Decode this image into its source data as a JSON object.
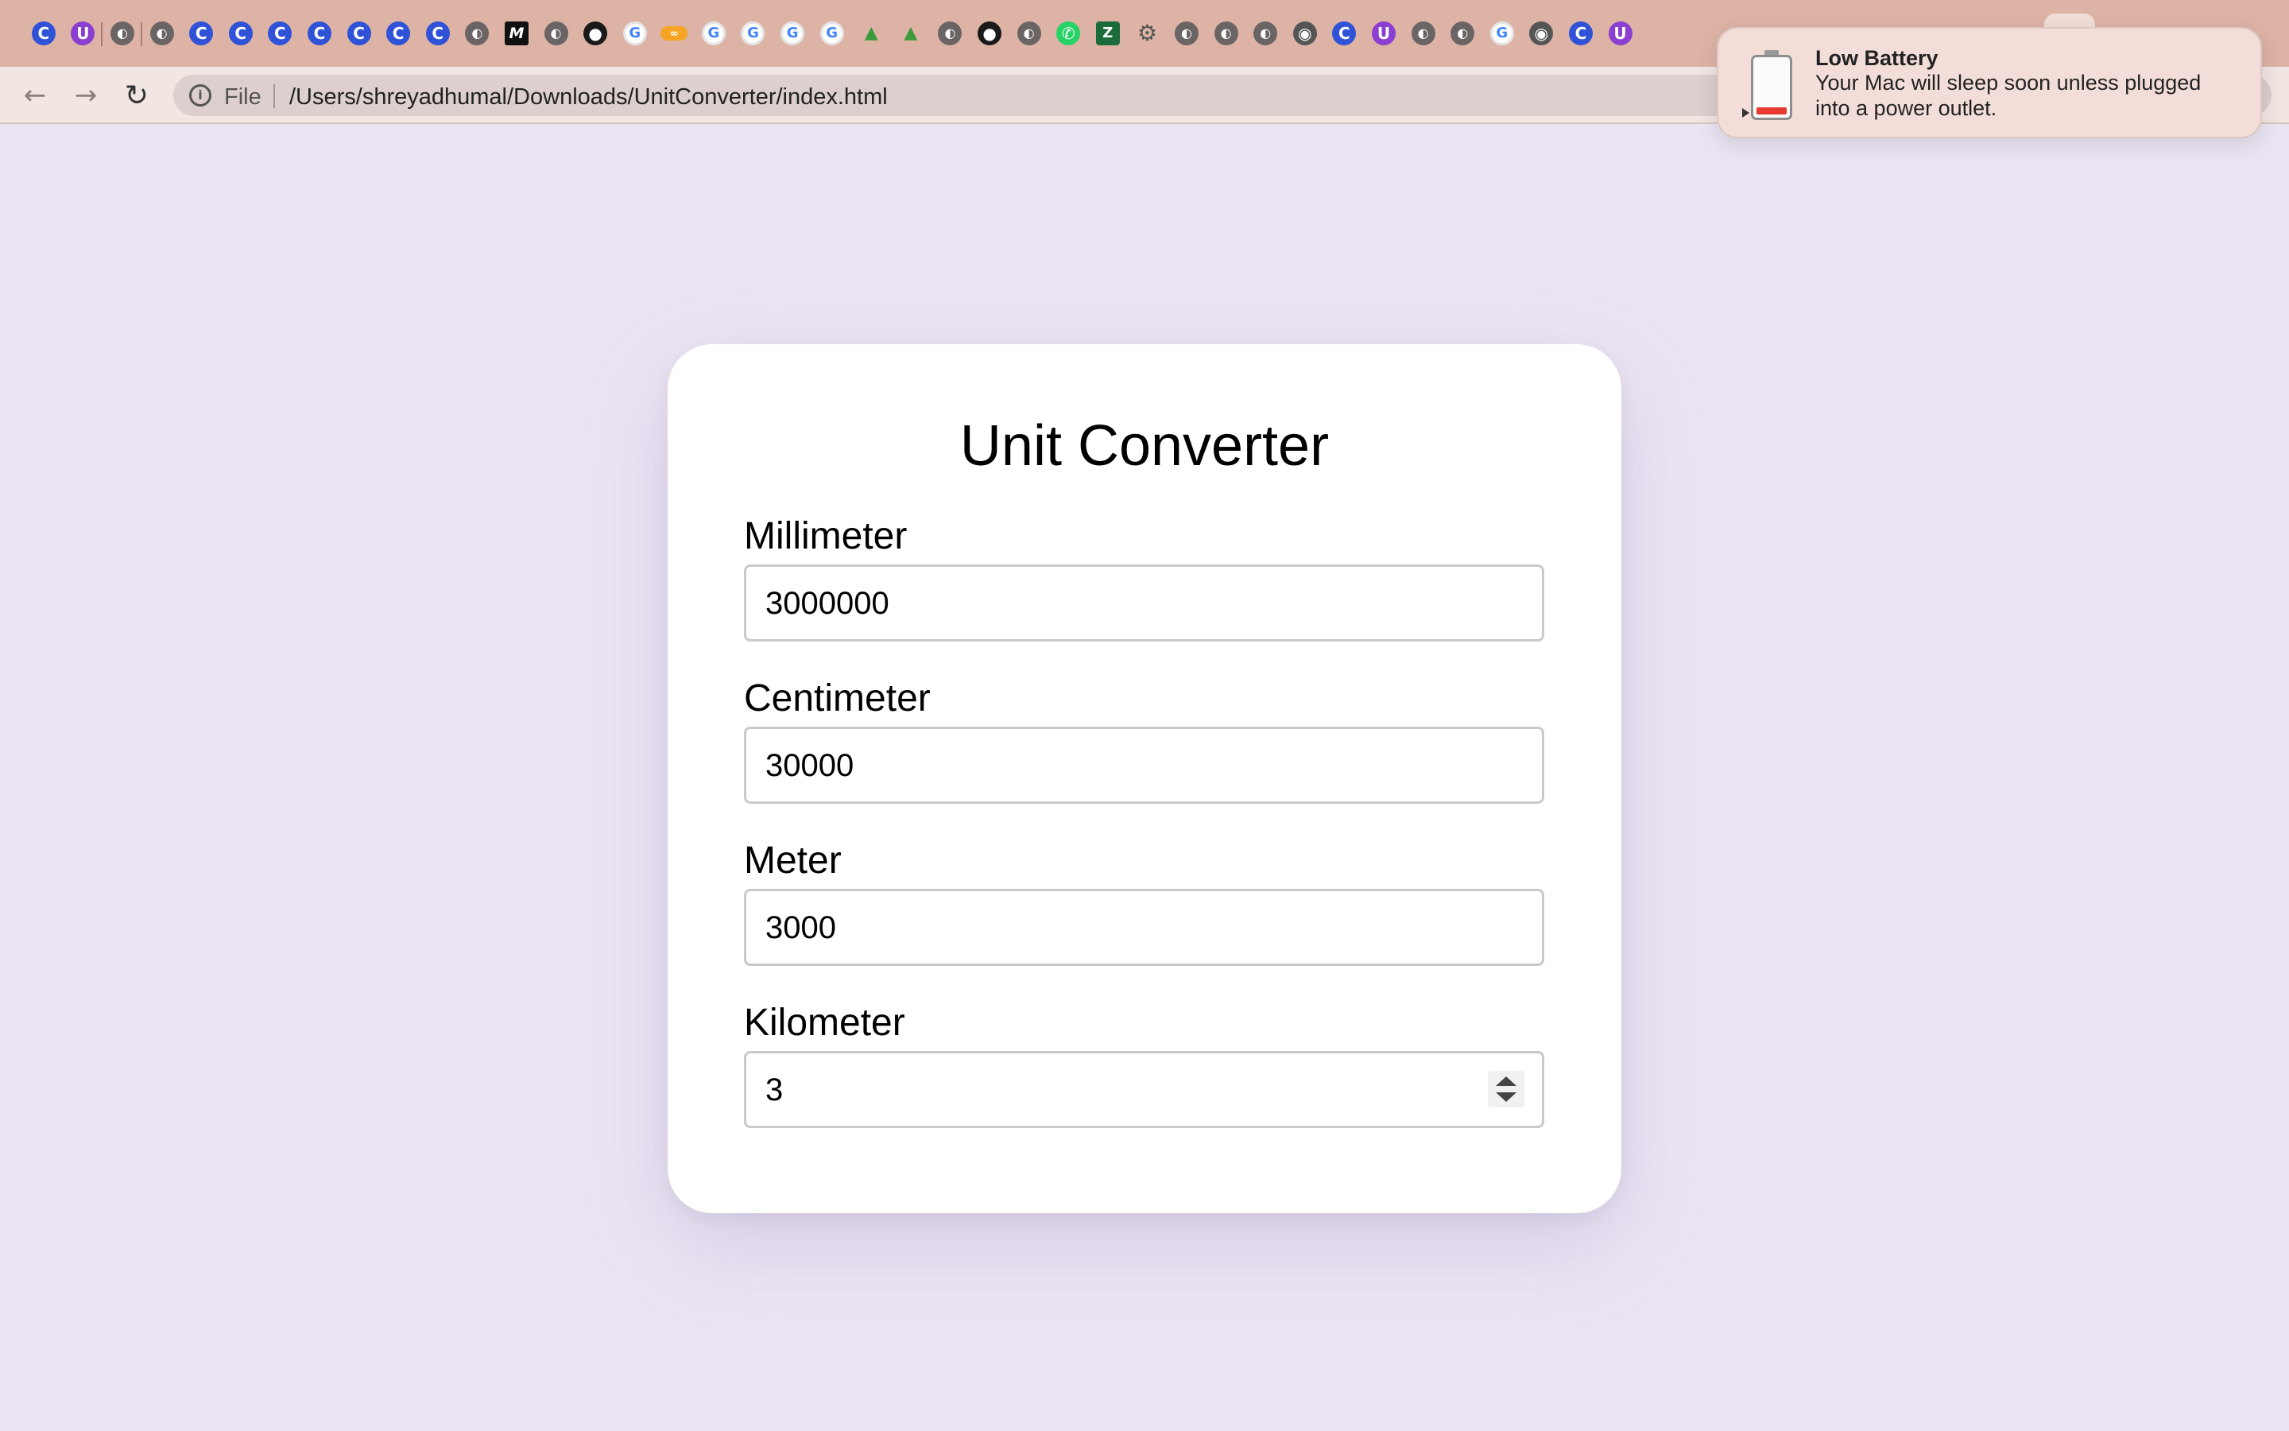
{
  "browser": {
    "tabs": [
      {
        "icon": "c-circle-icon",
        "glyph": "C"
      },
      {
        "icon": "u-circle-icon",
        "glyph": "U"
      },
      {
        "icon": "globe-icon",
        "glyph": "◐"
      },
      {
        "icon": "globe-icon",
        "glyph": "◐"
      },
      {
        "icon": "c-circle-icon",
        "glyph": "C"
      },
      {
        "icon": "c-circle-icon",
        "glyph": "C"
      },
      {
        "icon": "c-circle-icon",
        "glyph": "C"
      },
      {
        "icon": "c-circle-icon",
        "glyph": "C"
      },
      {
        "icon": "c-circle-icon",
        "glyph": "C"
      },
      {
        "icon": "c-circle-icon",
        "glyph": "C"
      },
      {
        "icon": "c-circle-icon",
        "glyph": "C"
      },
      {
        "icon": "globe-icon",
        "glyph": "◐"
      },
      {
        "icon": "m-square-icon",
        "glyph": "M"
      },
      {
        "icon": "globe-icon",
        "glyph": "◐"
      },
      {
        "icon": "github-icon",
        "glyph": "●"
      },
      {
        "icon": "google-icon",
        "glyph": "G"
      },
      {
        "icon": "orange-pill-icon",
        "glyph": "∞"
      },
      {
        "icon": "google-icon",
        "glyph": "G"
      },
      {
        "icon": "google-icon",
        "glyph": "G"
      },
      {
        "icon": "google-icon",
        "glyph": "G"
      },
      {
        "icon": "google-icon",
        "glyph": "G"
      },
      {
        "icon": "triangle-icon",
        "glyph": "▲"
      },
      {
        "icon": "triangle-icon",
        "glyph": "▲"
      },
      {
        "icon": "globe-icon",
        "glyph": "◐"
      },
      {
        "icon": "github-icon",
        "glyph": "●"
      },
      {
        "icon": "globe-icon",
        "glyph": "◐"
      },
      {
        "icon": "whatsapp-icon",
        "glyph": "✆"
      },
      {
        "icon": "zigzag-icon",
        "glyph": "Z"
      },
      {
        "icon": "gear-icon",
        "glyph": "⚙"
      },
      {
        "icon": "globe-icon",
        "glyph": "◐"
      },
      {
        "icon": "globe-icon",
        "glyph": "◐"
      },
      {
        "icon": "globe-icon",
        "glyph": "◐"
      },
      {
        "icon": "chrome-icon",
        "glyph": "◉"
      },
      {
        "icon": "c-circle-icon",
        "glyph": "C"
      },
      {
        "icon": "u-circle-icon",
        "glyph": "U"
      },
      {
        "icon": "globe-icon",
        "glyph": "◐"
      },
      {
        "icon": "globe-icon",
        "glyph": "◐"
      },
      {
        "icon": "google-icon",
        "glyph": "G"
      },
      {
        "icon": "chrome-icon",
        "glyph": "◉"
      },
      {
        "icon": "c-circle-icon",
        "glyph": "C"
      },
      {
        "icon": "u-circle-icon",
        "glyph": "U"
      }
    ],
    "scheme_label": "File",
    "url": "/Users/shreyadhumal/Downloads/UnitConverter/index.html",
    "back_glyph": "←",
    "forward_glyph": "→",
    "reload_glyph": "↻",
    "info_glyph": "i"
  },
  "page": {
    "title": "Unit Converter",
    "fields": [
      {
        "label": "Millimeter",
        "value": "3000000"
      },
      {
        "label": "Centimeter",
        "value": "30000"
      },
      {
        "label": "Meter",
        "value": "3000"
      },
      {
        "label": "Kilometer",
        "value": "3"
      }
    ]
  },
  "notification": {
    "title": "Low Battery",
    "body": "Your Mac will sleep soon unless plugged into a power outlet.",
    "battery_level": 0.12,
    "level_color": "#e63b30"
  },
  "colors": {
    "tabstrip": "#ddb3a6",
    "toolbar": "#f2e6e3",
    "page_background": "#ebe5f3",
    "card": "#ffffff"
  }
}
